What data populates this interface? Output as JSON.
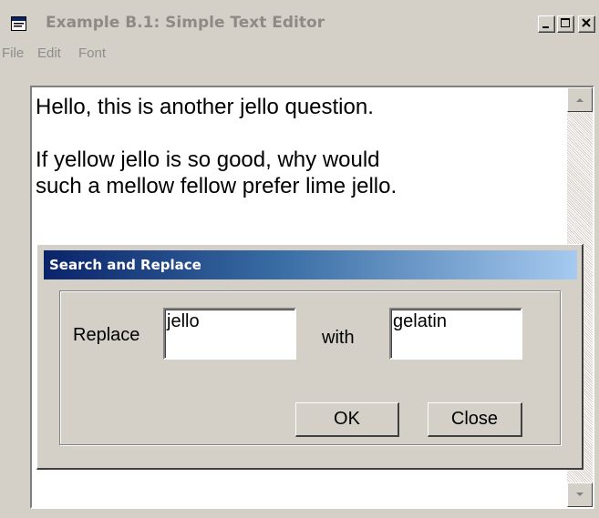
{
  "window": {
    "title": "Example B.1: Simple Text Editor",
    "icon": "app-window-icon",
    "controls": [
      "minimize-icon",
      "maximize-icon",
      "close-icon"
    ]
  },
  "menu": {
    "items": [
      {
        "label": "File"
      },
      {
        "label": "Edit"
      },
      {
        "label": "Font"
      }
    ]
  },
  "editor": {
    "text": "Hello, this is another jello question.\n\nIf yellow jello is so good, why would\nsuch a mellow fellow prefer lime jello."
  },
  "dialog": {
    "title": "Search and Replace",
    "replace_label": "Replace",
    "replace_value": "jello",
    "with_label": "with",
    "with_value": "gelatin",
    "ok_label": "OK",
    "close_label": "Close"
  },
  "colors": {
    "title_gradient_start": "#0a246a",
    "title_gradient_end": "#a6caf0",
    "face": "#d4d0c8"
  }
}
